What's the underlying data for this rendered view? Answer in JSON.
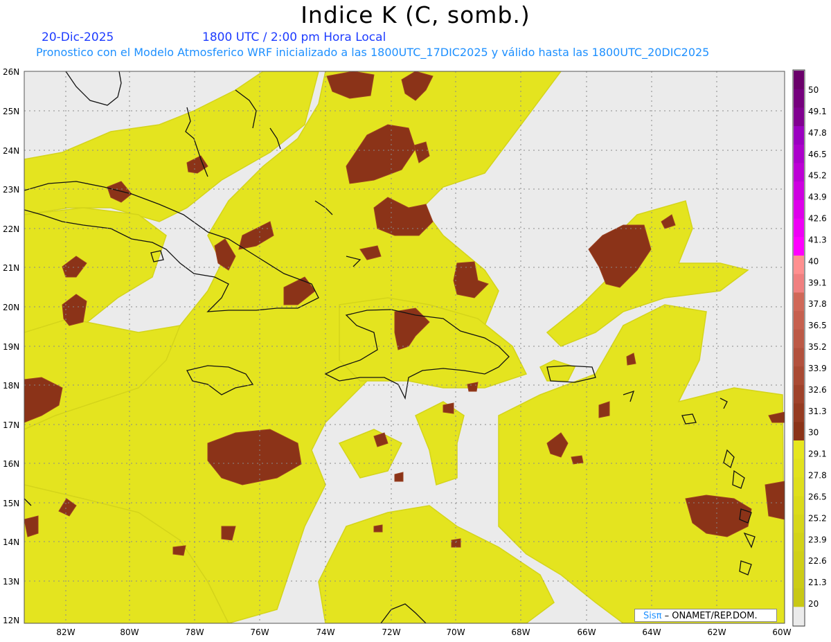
{
  "header": {
    "title": "Indice K (C, somb.)",
    "date": "20-Dic-2025",
    "time": "1800 UTC / 2:00 pm Hora Local",
    "subtitle": "Pronostico con el Modelo Atmosferico WRF inicializado a las 1800UTC_17DIC2025 y válido hasta las  1800UTC_20DIC2025"
  },
  "map": {
    "region": "Caribbean / Greater Antilles",
    "lon_range": [
      -83.2,
      -59.8
    ],
    "lat_range": [
      11.9,
      26.1
    ],
    "lat_labels": [
      "26N",
      "25N",
      "24N",
      "23N",
      "22N",
      "21N",
      "20N",
      "19N",
      "18N",
      "17N",
      "16N",
      "15N",
      "14N",
      "13N",
      "12N"
    ],
    "lon_labels": [
      "82W",
      "80W",
      "78W",
      "76W",
      "74W",
      "72W",
      "70W",
      "68W",
      "66W",
      "64W",
      "62W",
      "60W"
    ],
    "grid": "dotted"
  },
  "colorbar": {
    "labels": [
      "50",
      "49.1",
      "47.8",
      "46.5",
      "45.2",
      "43.9",
      "42.6",
      "41.3",
      "40",
      "39.1",
      "37.8",
      "36.5",
      "35.2",
      "33.9",
      "32.6",
      "31.3",
      "30",
      "29.1",
      "27.8",
      "26.5",
      "25.2",
      "23.9",
      "22.6",
      "21.3",
      "20"
    ],
    "colors": {
      "below_20": "#ebebeb",
      "band_20_30": "#e6e61e",
      "band_30_40": "#8b3318",
      "band_40_50": "#ff00ff",
      "top": "#6a006a"
    }
  },
  "credit": {
    "brand": "Sisπ",
    "text": "– ONAMET/REP.DOM."
  }
}
